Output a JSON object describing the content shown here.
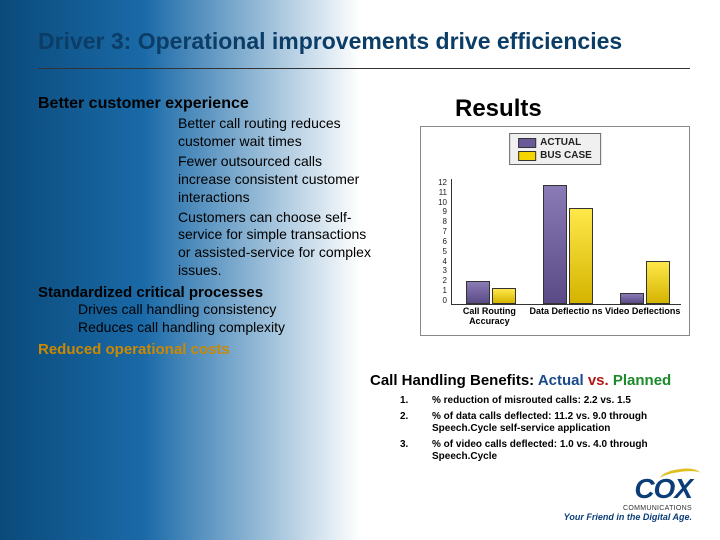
{
  "title": "Driver 3: Operational improvements drive efficiencies",
  "left": {
    "h1": "Better customer experience",
    "b1": "Better call routing reduces customer wait times",
    "b2": "Fewer outsourced calls increase consistent customer interactions",
    "b3": "Customers can choose self-service for simple transactions or assisted-service for complex issues.",
    "h2": "Standardized critical processes",
    "s1": "Drives call handling consistency",
    "s2": "Reduces call handling complexity",
    "h3": "Reduced operational costs"
  },
  "results_title": "Results",
  "legend": {
    "actual": "ACTUAL",
    "plan": "BUS CASE"
  },
  "chart_data": {
    "type": "bar",
    "ymax": 12,
    "yticks": [
      "0",
      "1",
      "2",
      "3",
      "4",
      "5",
      "6",
      "7",
      "8",
      "9",
      "10",
      "11",
      "12"
    ],
    "categories": [
      "Call Routing Accuracy",
      "Data Deflectio ns",
      "Video Deflections"
    ],
    "series": [
      {
        "name": "ACTUAL",
        "values": [
          2.2,
          11.2,
          1.0
        ]
      },
      {
        "name": "BUS CASE",
        "values": [
          1.5,
          9.0,
          4.0
        ]
      }
    ]
  },
  "chart_title": {
    "p1": "Call Handling Benefits:",
    "p2": "Actual",
    "p3": "vs.",
    "p4": "Planned"
  },
  "notes": [
    {
      "n": "1.",
      "t": "% reduction of misrouted calls: 2.2 vs. 1.5"
    },
    {
      "n": "2.",
      "t": "% of data calls deflected: 11.2 vs. 9.0 through Speech.Cycle self-service application"
    },
    {
      "n": "3.",
      "t": "% of video calls deflected: 1.0 vs. 4.0 through Speech.Cycle"
    }
  ],
  "logo": {
    "name": "COX",
    "sub": "COMMUNICATIONS",
    "tag": "Your Friend in the Digital Age."
  }
}
